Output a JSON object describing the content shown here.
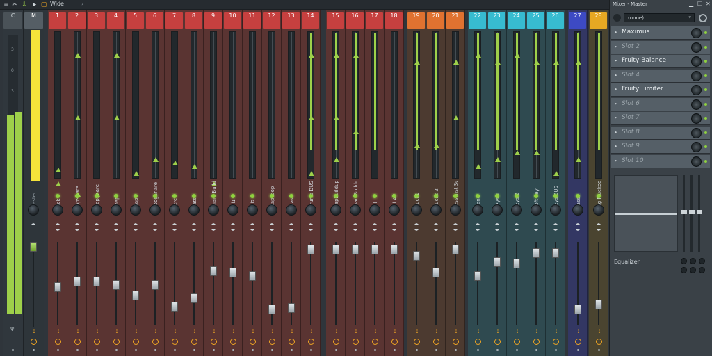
{
  "window": {
    "mode_label": "Wide"
  },
  "master": {
    "header_c": "C",
    "header_m": "M",
    "label": "Master",
    "ticks": [
      "3",
      "0",
      "3"
    ]
  },
  "tracks": [
    {
      "num": "1",
      "name": "Kick",
      "color": "#c6403f",
      "fader": 0.47
    },
    {
      "num": "2",
      "name": "PopSnare",
      "color": "#c6403f",
      "fader": 0.55
    },
    {
      "num": "3",
      "name": "TrapSnare",
      "color": "#c6403f",
      "fader": 0.55
    },
    {
      "num": "4",
      "name": "Snap",
      "color": "#c6403f",
      "fader": 0.5
    },
    {
      "num": "5",
      "name": "Clap",
      "color": "#c6403f",
      "fader": 0.36
    },
    {
      "num": "6",
      "name": "BoogSnare",
      "color": "#c6403f",
      "fader": 0.5
    },
    {
      "num": "7",
      "name": "Perc",
      "color": "#c6403f",
      "fader": 0.22
    },
    {
      "num": "8",
      "name": "Hats",
      "color": "#c6403f",
      "fader": 0.33
    },
    {
      "num": "9",
      "name": "Snare Buildup",
      "color": "#c6403f",
      "fader": 0.68
    },
    {
      "num": "10",
      "name": "Fill1",
      "color": "#c6403f",
      "fader": 0.66
    },
    {
      "num": "11",
      "name": "Fill2",
      "color": "#c6403f",
      "fader": 0.62
    },
    {
      "num": "12",
      "name": "ClapLoop",
      "color": "#c6403f",
      "fader": 0.18
    },
    {
      "num": "13",
      "name": "Crash",
      "color": "#c6403f",
      "fader": 0.2
    },
    {
      "num": "14",
      "name": "Drums BUS",
      "color": "#c6403f",
      "fader": 0.96
    },
    {
      "num": "15",
      "name": "clapBuildup",
      "color": "#c6403f",
      "fader": 0.96
    },
    {
      "num": "16",
      "name": "snareBuildup",
      "color": "#c6403f",
      "fader": 0.96
    },
    {
      "num": "17",
      "name": "Fill",
      "color": "#c6403f",
      "fader": 0.96
    },
    {
      "num": "18",
      "name": "Fill #2",
      "color": "#c6403f",
      "fader": 0.96
    },
    {
      "num": "19",
      "name": "Pluck1",
      "color": "#e07230",
      "fader": 0.88
    },
    {
      "num": "20",
      "name": "Plucks 2",
      "color": "#e07230",
      "fader": 0.66
    },
    {
      "num": "21",
      "name": "Lessonst SoftPluck",
      "color": "#e07230",
      "fader": 0.96
    },
    {
      "num": "22",
      "name": "Piano",
      "color": "#37bcd0",
      "fader": 0.62
    },
    {
      "num": "23",
      "name": "Keys 1",
      "color": "#37bcd0",
      "fader": 0.8
    },
    {
      "num": "24",
      "name": "Keys 2",
      "color": "#37bcd0",
      "fader": 0.78
    },
    {
      "num": "25",
      "name": "Soft Key",
      "color": "#37bcd0",
      "fader": 0.92
    },
    {
      "num": "26",
      "name": "Keys BUS",
      "color": "#37bcd0",
      "fader": 0.92
    },
    {
      "num": "27",
      "name": "Bass",
      "color": "#3d4ac4",
      "fader": 0.18
    },
    {
      "num": "28",
      "name": "Big Plucked Synth",
      "color": "#e6a823",
      "fader": 0.25
    }
  ],
  "panel": {
    "title": "Mixer - Master",
    "preset": "(none)",
    "slots": [
      {
        "name": "Maximus",
        "empty": false
      },
      {
        "name": "Slot 2",
        "empty": true
      },
      {
        "name": "Fruity Balance",
        "empty": false
      },
      {
        "name": "Slot 4",
        "empty": true
      },
      {
        "name": "Fruity Limiter",
        "empty": false
      },
      {
        "name": "Slot 6",
        "empty": true
      },
      {
        "name": "Slot 7",
        "empty": true
      },
      {
        "name": "Slot 8",
        "empty": true
      },
      {
        "name": "Slot 9",
        "empty": true
      },
      {
        "name": "Slot 10",
        "empty": true
      }
    ],
    "eq_label": "Equalizer"
  },
  "colors": {
    "green": "#9ed04a",
    "yellow": "#f5e33a",
    "route": "#f0a623"
  }
}
